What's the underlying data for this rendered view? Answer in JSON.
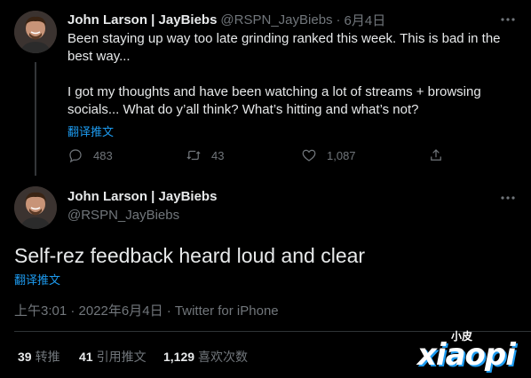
{
  "tweet1": {
    "display_name": "John Larson | JayBiebs",
    "handle": "@RSPN_JayBiebs",
    "sep": "·",
    "date": "6月4日",
    "text_p1": "Been staying up way too late grinding ranked this week. This is bad in the best way...",
    "text_p2": "I got my thoughts and have been watching a lot of streams + browsing socials... What do y’all think? What’s hitting and what’s not?",
    "translate_label": "翻译推文",
    "replies": "483",
    "retweets": "43",
    "likes": "1,087"
  },
  "tweet2": {
    "display_name": "John Larson | JayBiebs",
    "handle": "@RSPN_JayBiebs",
    "text": "Self-rez feedback heard loud and clear",
    "translate_label": "翻译推文",
    "timestamp": "上午3:01 · 2022年6月4日 · Twitter for iPhone",
    "stats": {
      "retweets_count": "39",
      "retweets_label": "转推",
      "quotes_count": "41",
      "quotes_label": "引用推文",
      "likes_count": "1,129",
      "likes_label": "喜欢次数"
    }
  },
  "watermark": {
    "top": "小皮",
    "main": "xiaopi"
  },
  "colors": {
    "background": "#000000",
    "text": "#e7e9ea",
    "secondary": "#71767b",
    "link": "#1d9bf0",
    "divider": "#2f3336"
  },
  "icons": [
    "reply-icon",
    "retweet-icon",
    "like-icon",
    "share-icon",
    "more-icon"
  ]
}
